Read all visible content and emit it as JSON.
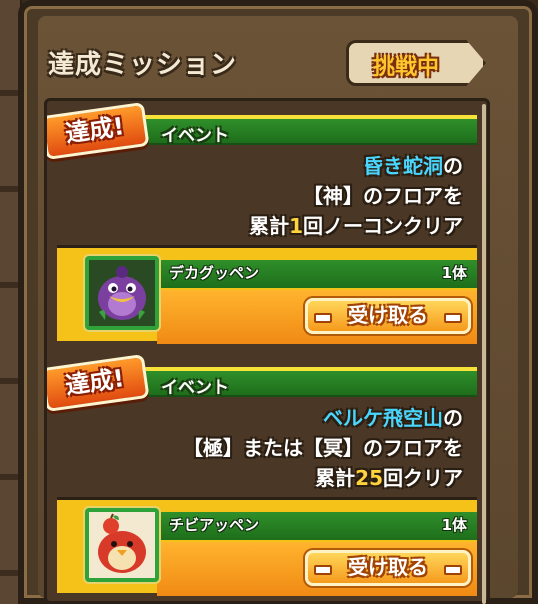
{
  "panel": {
    "title": "達成ミッション",
    "status_tab": "挑戦中"
  },
  "missions": [
    {
      "badge": "達成!",
      "category": "イベント",
      "desc": {
        "line1_highlight": "昏き蛇洞",
        "line1_suffix": "の",
        "line2": "【神】のフロアを",
        "line3_prefix": "累計",
        "line3_number": "1",
        "line3_suffix": "回ノーコンクリア"
      },
      "reward": {
        "name": "デカグッペン",
        "count": "1体",
        "monster_icon": "purple-penguin-monster-icon",
        "button": "受け取る"
      }
    },
    {
      "badge": "達成!",
      "category": "イベント",
      "desc": {
        "line1_highlight": "ベルケ飛空山",
        "line1_suffix": "の",
        "line2": "【極】または【冥】のフロアを",
        "line3_prefix": "累計",
        "line3_number": "25",
        "line3_suffix": "回クリア"
      },
      "reward": {
        "name": "チビアッペン",
        "count": "1体",
        "monster_icon": "red-apple-bird-monster-icon",
        "button": "受け取る"
      }
    }
  ],
  "colors": {
    "highlight_cyan": "#49d7ff",
    "highlight_yellow": "#ffd33d",
    "header_green": "#2f8f2a",
    "reward_yellow": "#f5c21a"
  }
}
